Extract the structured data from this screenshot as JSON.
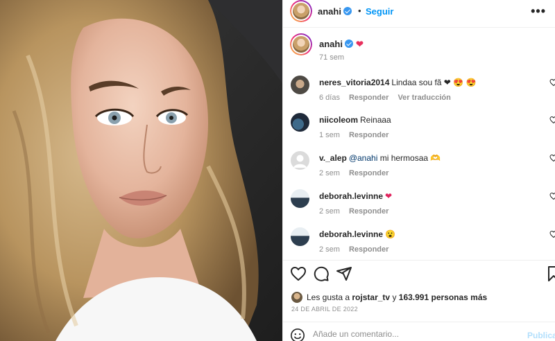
{
  "post": {
    "author": "anahi",
    "follow_label": "Seguir",
    "separator": "•",
    "more_label": "•••",
    "caption": {
      "username": "anahi",
      "emoji": "❤",
      "time": "71 sem"
    }
  },
  "comments": [
    {
      "username": "neres_vitoria2014",
      "text": "Lindaa sou fã ❤ 😍 😍",
      "time": "6 días",
      "reply": "Responder",
      "translate": "Ver traducción"
    },
    {
      "username": "niicoleom",
      "text": "Reinaaa",
      "time": "1 sem",
      "reply": "Responder"
    },
    {
      "username": "v._alep",
      "mention": "@anahi",
      "text": "mi hermosaa 🫶",
      "time": "2 sem",
      "reply": "Responder"
    },
    {
      "username": "deborah.levinne",
      "text": "❤",
      "time": "2 sem",
      "reply": "Responder"
    },
    {
      "username": "deborah.levinne",
      "text": "😮",
      "time": "2 sem",
      "reply": "Responder"
    }
  ],
  "likes": {
    "prefix": "Les gusta a",
    "user": "rojstar_tv",
    "conj": "y",
    "count_text": "163.991 personas más"
  },
  "date": "24 DE ABRIL DE 2022",
  "add_comment": {
    "placeholder": "Añade un comentario...",
    "publish_label": "Publicar"
  },
  "colors": {
    "accent": "#0095f6",
    "verified": "#3897f0",
    "muted": "#8e8e8e",
    "text": "#262626"
  },
  "icons": [
    "verified-badge-icon",
    "more-options-icon",
    "heart-icon",
    "comment-icon",
    "share-icon",
    "bookmark-icon",
    "emoji-icon"
  ]
}
